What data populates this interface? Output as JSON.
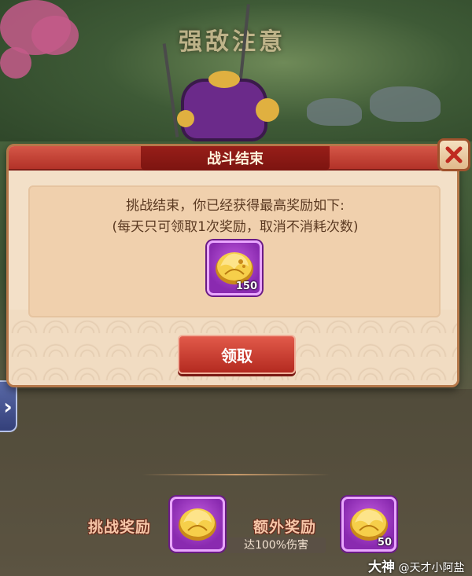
{
  "scene": {
    "warning_text": "强敌注意"
  },
  "dialog": {
    "title": "战斗结束",
    "message_line1": "挑战结束，你已经获得最高奖励如下:",
    "message_line2": "(每天只可领取1次奖励，取消不消耗次数)",
    "reward": {
      "icon": "gold-ingot-icon",
      "count": "150"
    },
    "claim_button": "领取",
    "close_icon": "close-icon"
  },
  "side_nav": {
    "icon": "chevron-right-icon"
  },
  "bottom": {
    "challenge_reward_label": "挑战奖励",
    "extra_reward_label": "额外奖励",
    "extra_reward_condition": "达100%伤害",
    "extra_reward_count": "50"
  },
  "watermark": {
    "brand": "大神",
    "handle": "@天才小阿盐"
  },
  "colors": {
    "header_red": "#b23228",
    "dialog_bg": "#f3e0c8",
    "item_purple": "#8a2ab0",
    "button_red": "#c8382c"
  }
}
